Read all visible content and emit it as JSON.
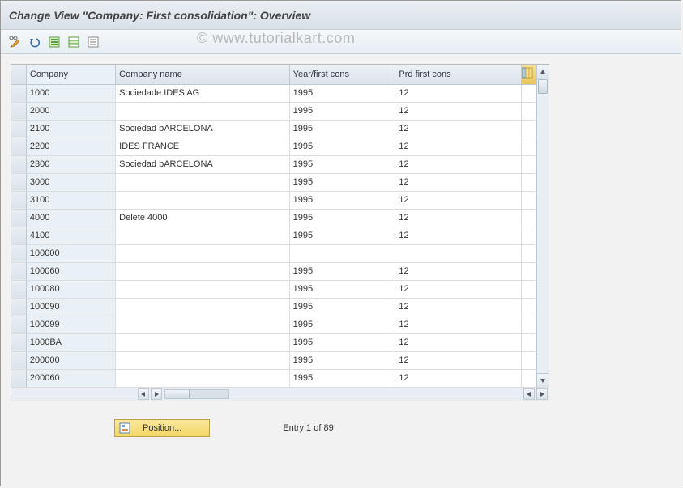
{
  "title": "Change View \"Company: First consolidation\": Overview",
  "watermark": "© www.tutorialkart.com",
  "columns": {
    "company": "Company",
    "name": "Company name",
    "year": "Year/first cons",
    "prd": "Prd first cons"
  },
  "rows": [
    {
      "company": "1000",
      "name": "Sociedade IDES AG",
      "year": "1995",
      "prd": "12"
    },
    {
      "company": "2000",
      "name": "",
      "year": "1995",
      "prd": "12"
    },
    {
      "company": "2100",
      "name": "Sociedad bARCELONA",
      "year": "1995",
      "prd": "12"
    },
    {
      "company": "2200",
      "name": "IDES FRANCE",
      "year": "1995",
      "prd": "12"
    },
    {
      "company": "2300",
      "name": "Sociedad bARCELONA",
      "year": "1995",
      "prd": "12"
    },
    {
      "company": "3000",
      "name": "",
      "year": "1995",
      "prd": "12"
    },
    {
      "company": "3100",
      "name": "",
      "year": "1995",
      "prd": "12"
    },
    {
      "company": "4000",
      "name": "Delete 4000",
      "year": "1995",
      "prd": "12"
    },
    {
      "company": "4100",
      "name": "",
      "year": "1995",
      "prd": "12"
    },
    {
      "company": "100000",
      "name": "",
      "year": "",
      "prd": ""
    },
    {
      "company": "100060",
      "name": "",
      "year": "1995",
      "prd": "12"
    },
    {
      "company": "100080",
      "name": "",
      "year": "1995",
      "prd": "12"
    },
    {
      "company": "100090",
      "name": "",
      "year": "1995",
      "prd": "12"
    },
    {
      "company": "100099",
      "name": "",
      "year": "1995",
      "prd": "12"
    },
    {
      "company": "1000BA",
      "name": "",
      "year": "1995",
      "prd": "12"
    },
    {
      "company": "200000",
      "name": "",
      "year": "1995",
      "prd": "12"
    },
    {
      "company": "200060",
      "name": "",
      "year": "1995",
      "prd": "12"
    }
  ],
  "position_button": "Position...",
  "status": "Entry 1 of 89"
}
